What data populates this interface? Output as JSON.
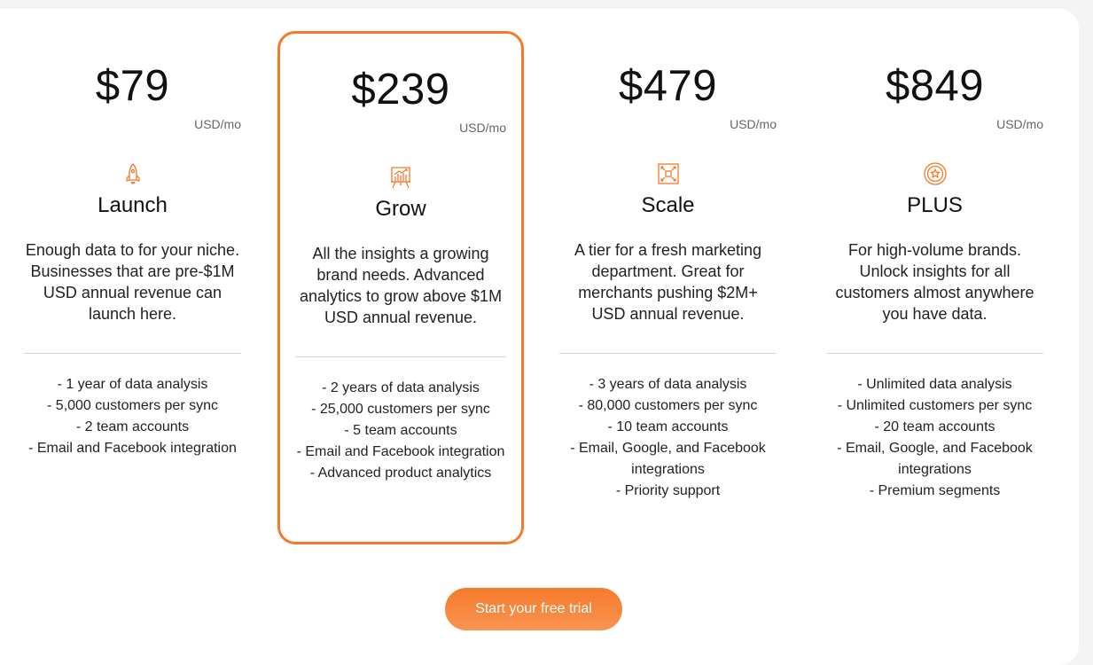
{
  "accent_color": "#f47a2a",
  "tiers": [
    {
      "price": "$79",
      "unit": "USD/mo",
      "icon": "rocket-icon",
      "name": "Launch",
      "description": "Enough data to for your niche.  Businesses that are pre-$1M USD annual revenue can launch here.",
      "features": [
        "- 1 year of data analysis",
        "- 5,000 customers per sync",
        "- 2 team accounts",
        "- Email and Facebook integration"
      ],
      "highlighted": false
    },
    {
      "price": "$239",
      "unit": "USD/mo",
      "icon": "growth-chart-easel-icon",
      "name": "Grow",
      "description": "All the insights a growing brand needs. Advanced analytics to grow above $1M USD annual revenue.",
      "features": [
        "- 2 years of data analysis",
        "- 25,000 customers per sync",
        "- 5 team accounts",
        "- Email and Facebook integration",
        "- Advanced product analytics"
      ],
      "highlighted": true
    },
    {
      "price": "$479",
      "unit": "USD/mo",
      "icon": "scale-expand-icon",
      "name": "Scale",
      "description": "A tier for a fresh marketing department. Great for merchants pushing $2M+ USD annual revenue.",
      "features": [
        "- 3 years of data analysis",
        "- 80,000 customers per sync",
        "- 10 team accounts",
        "- Email, Google, and Facebook integrations",
        "- Priority support"
      ],
      "highlighted": false
    },
    {
      "price": "$849",
      "unit": "USD/mo",
      "icon": "star-badge-icon",
      "name": "PLUS",
      "description": "For high-volume brands. Unlock insights for all customers almost anywhere you have data.",
      "features": [
        "- Unlimited data analysis",
        "- Unlimited customers per sync",
        "- 20 team accounts",
        "- Email, Google, and Facebook integrations",
        "- Premium segments"
      ],
      "highlighted": false
    }
  ],
  "cta": {
    "label": "Start your free trial"
  }
}
